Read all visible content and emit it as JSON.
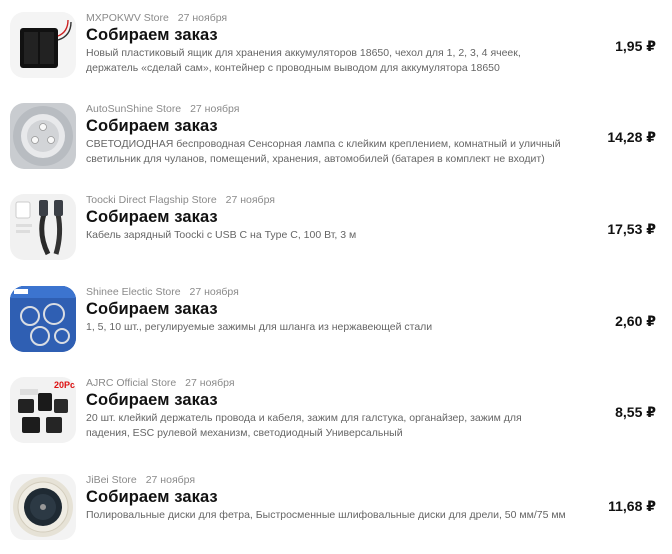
{
  "orders": [
    {
      "store": "MXPOKWV Store",
      "date": "27 ноября",
      "status": "Собираем заказ",
      "description": "Новый пластиковый ящик для хранения аккумуляторов 18650, чехол для 1, 2, 3, 4 ячеек, держатель «сделай сам», контейнер с проводным выводом для аккумулятора 18650",
      "price": "1,95 ₽",
      "image_icon": "battery-holder-icon"
    },
    {
      "store": "AutoSunShine Store",
      "date": "27 ноября",
      "status": "Собираем заказ",
      "description": "СВЕТОДИОДНАЯ беспроводная Сенсорная лампа с клейким креплением, комнатный и уличный светильник для чуланов, помещений, хранения, автомобилей (батарея в комплект не входит)",
      "price": "14,28 ₽",
      "image_icon": "touch-lamp-icon"
    },
    {
      "store": "Toocki Direct Flagship Store",
      "date": "27 ноября",
      "status": "Собираем заказ",
      "description": "Кабель зарядный Toocki с USB C на Type C, 100 Вт, 3 м",
      "price": "17,53 ₽",
      "image_icon": "usb-cable-icon"
    },
    {
      "store": "Shinee Electic Store",
      "date": "27 ноября",
      "status": "Собираем заказ",
      "description": "1, 5, 10 шт., регулируемые зажимы для шланга из нержавеющей стали",
      "price": "2,60 ₽",
      "image_icon": "hose-clamps-icon"
    },
    {
      "store": "AJRC Official Store",
      "date": "27 ноября",
      "status": "Собираем заказ",
      "description": "20 шт. клейкий держатель провода и кабеля, зажим для галстука, органайзер, зажим для падения, ESC рулевой механизм, светодиодный Универсальный",
      "price": "8,55 ₽",
      "image_icon": "cable-clips-icon",
      "image_badge": "20Pc"
    },
    {
      "store": "JiBei Store",
      "date": "27 ноября",
      "status": "Собираем заказ",
      "description": "Полировальные диски для фетра, Быстросменные шлифовальные диски для дрели, 50 мм/75 мм",
      "price": "11,68 ₽",
      "image_icon": "polishing-disc-icon"
    }
  ]
}
